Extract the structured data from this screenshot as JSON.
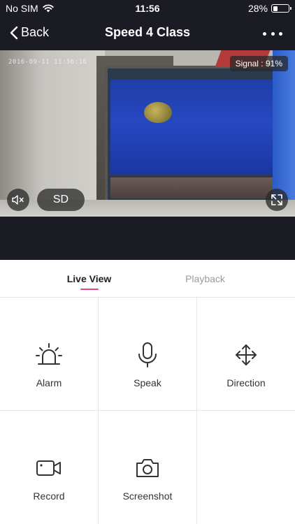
{
  "status_bar": {
    "carrier": "No SIM",
    "time": "11:56",
    "battery_percent": "28%",
    "battery_level": 0.28
  },
  "nav": {
    "back_label": "Back",
    "title": "Speed 4 Class",
    "more_icon": "more-horizontal-icon"
  },
  "video": {
    "timestamp": "2016-09-11 11:56:16",
    "signal": "Signal : 91%",
    "quality_label": "SD",
    "mute_icon": "speaker-muted-icon",
    "fullscreen_icon": "fullscreen-icon"
  },
  "tabs": [
    {
      "label": "Live View",
      "active": true
    },
    {
      "label": "Playback",
      "active": false
    }
  ],
  "actions": [
    {
      "label": "Alarm",
      "icon": "alarm-siren-icon"
    },
    {
      "label": "Speak",
      "icon": "microphone-icon"
    },
    {
      "label": "Direction",
      "icon": "move-arrows-icon"
    },
    {
      "label": "Record",
      "icon": "video-camera-icon"
    },
    {
      "label": "Screenshot",
      "icon": "camera-icon"
    }
  ],
  "colors": {
    "header_bg": "#1b1b24",
    "accent": "#e6457a",
    "divider": "#e6e6e6"
  }
}
